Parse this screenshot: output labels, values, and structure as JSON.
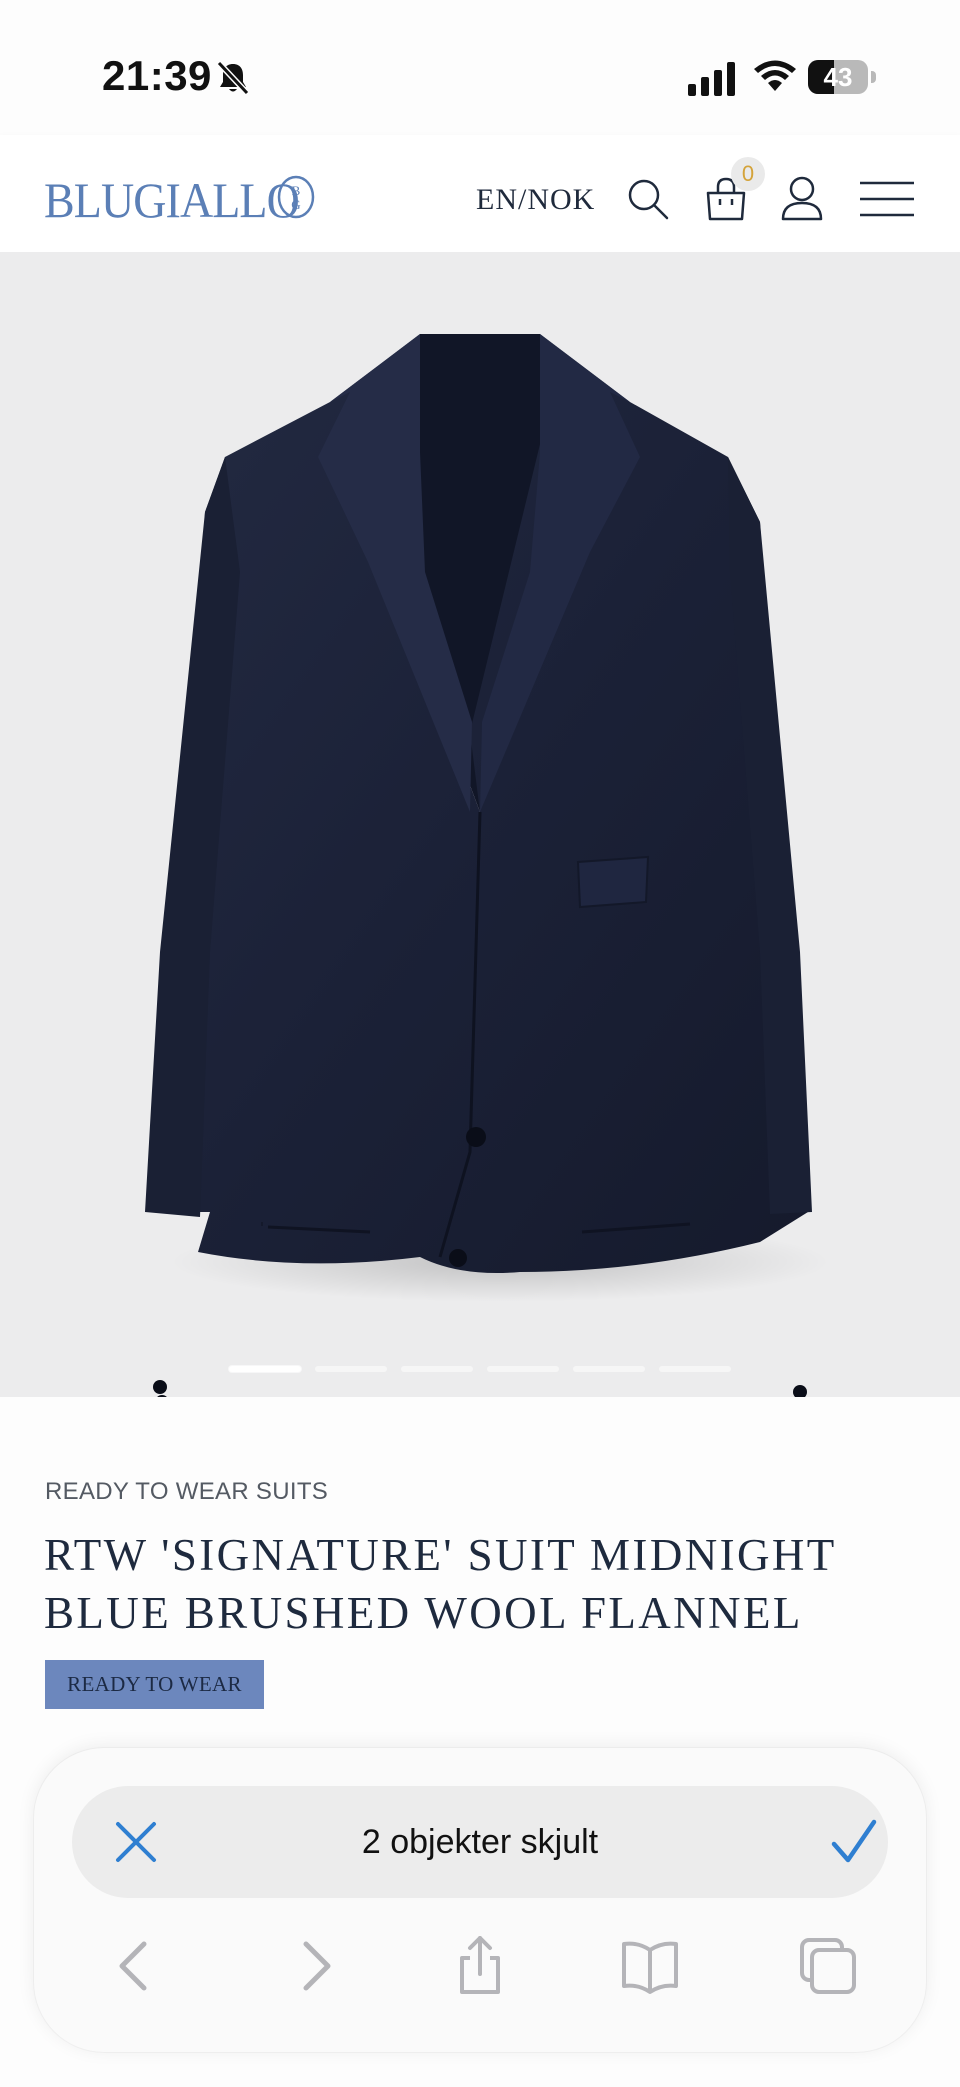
{
  "status_bar": {
    "time": "21:39",
    "battery_level": "43",
    "battery_fraction": 0.43,
    "icons": [
      "bell-slash-icon",
      "cellular-signal-icon",
      "wifi-icon",
      "battery-icon"
    ]
  },
  "header": {
    "logo_text": "BLUGIALLO",
    "logo_mark": "BG",
    "locale": "EN/NOK",
    "cart_count": "0",
    "brand_color": "#5b7fb6",
    "icons": [
      "search-icon",
      "bag-icon",
      "user-icon",
      "hamburger-menu-icon"
    ]
  },
  "gallery": {
    "image": "navy-blazer",
    "slide_count": 6,
    "active_slide": 1
  },
  "product": {
    "category": "READY TO WEAR SUITS",
    "title": "RTW 'SIGNATURE' SUIT MIDNIGHT BLUE BRUSHED WOOL FLANNEL",
    "tag": "READY TO WEAR",
    "tag_color": "#6c87bd"
  },
  "safari_bar": {
    "message": "2 objekter skjult",
    "accent": "#2f7fd1",
    "toolbar_icons": [
      "back-chevron-icon",
      "forward-chevron-icon",
      "share-icon",
      "bookmarks-icon",
      "tabs-icon"
    ]
  }
}
